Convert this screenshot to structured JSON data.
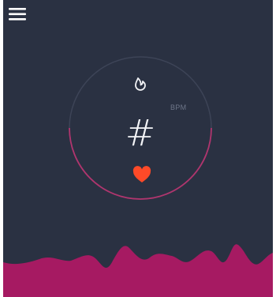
{
  "status": {
    "bpm_label": "BPM",
    "bpm_value": "#"
  },
  "icons": {
    "menu": "hamburger-menu-icon",
    "flame": "flame-icon",
    "heart": "heart-icon"
  },
  "colors": {
    "background": "#2a3142",
    "ring": "#b0356e",
    "ring_track": "#3d4457",
    "heart": "#ff4a28",
    "wave": "#a61a62",
    "text": "#f4f5f8",
    "muted_text": "#6e7689"
  }
}
